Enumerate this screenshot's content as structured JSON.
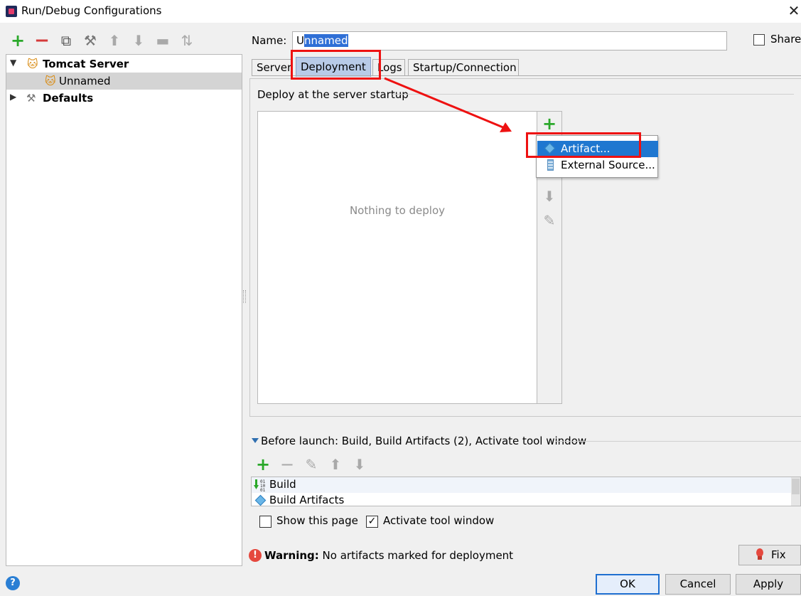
{
  "window": {
    "title": "Run/Debug Configurations",
    "close_glyph": "✕"
  },
  "toolbar": {
    "add": "+",
    "remove": "−",
    "copy": "⧉",
    "edit": "⚒",
    "up": "⬆",
    "down": "⬇",
    "folder": "▬",
    "sort": "⇅"
  },
  "tree": {
    "items": [
      {
        "label": "Tomcat Server",
        "expanded": true,
        "icon": "tomcat-icon"
      },
      {
        "label": "Unnamed",
        "icon": "tomcat-config-icon",
        "selected": true
      },
      {
        "label": "Defaults",
        "expanded": false,
        "icon": "defaults-wrench-icon"
      }
    ]
  },
  "name": {
    "label": "Name:",
    "value_first": "U",
    "value_rest": "nnamed"
  },
  "share": {
    "label": "Share",
    "checked": false
  },
  "tabs": [
    "Server",
    "Deployment",
    "Logs",
    "Startup/Connection"
  ],
  "active_tab": "Deployment",
  "deployment": {
    "section_label": "Deploy at the server startup",
    "empty_text": "Nothing to deploy",
    "side_add": "+",
    "side_down": "⬇",
    "side_edit": "✎"
  },
  "popup": {
    "items": [
      {
        "label": "Artifact...",
        "icon": "artifact-icon",
        "selected": true
      },
      {
        "label": "External Source...",
        "icon": "external-source-icon",
        "selected": false
      }
    ]
  },
  "before_launch": {
    "label": "Before launch: Build, Build Artifacts (2), Activate tool window",
    "toolbar": {
      "add": "+",
      "remove": "−",
      "edit": "✎",
      "up": "⬆",
      "down": "⬇"
    },
    "items": [
      {
        "label": "Build",
        "icon": "build-icon"
      },
      {
        "label": "Build Artifacts",
        "icon": "artifact-icon"
      }
    ],
    "show_this_page": {
      "label": "Show this page",
      "checked": false
    },
    "activate_tool_window": {
      "label": "Activate tool window",
      "checked": true
    }
  },
  "warning": {
    "icon": "!",
    "bold": "Warning:",
    "text": "No artifacts marked for deployment"
  },
  "fix_button": "Fix",
  "buttons": {
    "help": "?",
    "ok": "OK",
    "cancel": "Cancel",
    "apply": "Apply"
  },
  "colors": {
    "selection_blue": "#1f77d0",
    "active_tab": "#b8cbe8",
    "annotation_red": "#ee1111",
    "add_green": "#2aa82a",
    "remove_red": "#d53a3a"
  }
}
